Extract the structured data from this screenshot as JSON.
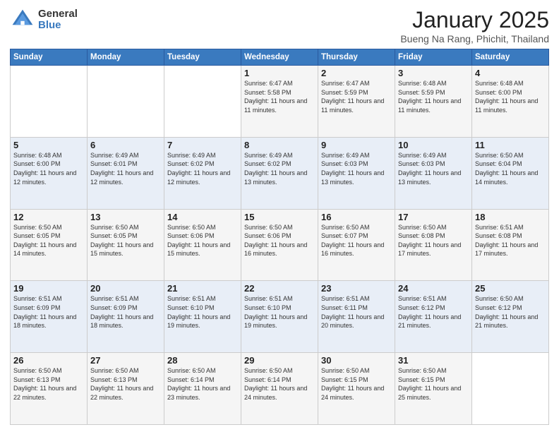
{
  "logo": {
    "general": "General",
    "blue": "Blue"
  },
  "header": {
    "month": "January 2025",
    "location": "Bueng Na Rang, Phichit, Thailand"
  },
  "weekdays": [
    "Sunday",
    "Monday",
    "Tuesday",
    "Wednesday",
    "Thursday",
    "Friday",
    "Saturday"
  ],
  "weeks": [
    [
      {
        "day": "",
        "empty": true
      },
      {
        "day": "",
        "empty": true
      },
      {
        "day": "",
        "empty": true
      },
      {
        "day": "1",
        "sunrise": "6:47 AM",
        "sunset": "5:58 PM",
        "daylight": "11 hours and 11 minutes."
      },
      {
        "day": "2",
        "sunrise": "6:47 AM",
        "sunset": "5:59 PM",
        "daylight": "11 hours and 11 minutes."
      },
      {
        "day": "3",
        "sunrise": "6:48 AM",
        "sunset": "5:59 PM",
        "daylight": "11 hours and 11 minutes."
      },
      {
        "day": "4",
        "sunrise": "6:48 AM",
        "sunset": "6:00 PM",
        "daylight": "11 hours and 11 minutes."
      }
    ],
    [
      {
        "day": "5",
        "sunrise": "6:48 AM",
        "sunset": "6:00 PM",
        "daylight": "11 hours and 12 minutes."
      },
      {
        "day": "6",
        "sunrise": "6:49 AM",
        "sunset": "6:01 PM",
        "daylight": "11 hours and 12 minutes."
      },
      {
        "day": "7",
        "sunrise": "6:49 AM",
        "sunset": "6:02 PM",
        "daylight": "11 hours and 12 minutes."
      },
      {
        "day": "8",
        "sunrise": "6:49 AM",
        "sunset": "6:02 PM",
        "daylight": "11 hours and 13 minutes."
      },
      {
        "day": "9",
        "sunrise": "6:49 AM",
        "sunset": "6:03 PM",
        "daylight": "11 hours and 13 minutes."
      },
      {
        "day": "10",
        "sunrise": "6:49 AM",
        "sunset": "6:03 PM",
        "daylight": "11 hours and 13 minutes."
      },
      {
        "day": "11",
        "sunrise": "6:50 AM",
        "sunset": "6:04 PM",
        "daylight": "11 hours and 14 minutes."
      }
    ],
    [
      {
        "day": "12",
        "sunrise": "6:50 AM",
        "sunset": "6:05 PM",
        "daylight": "11 hours and 14 minutes."
      },
      {
        "day": "13",
        "sunrise": "6:50 AM",
        "sunset": "6:05 PM",
        "daylight": "11 hours and 15 minutes."
      },
      {
        "day": "14",
        "sunrise": "6:50 AM",
        "sunset": "6:06 PM",
        "daylight": "11 hours and 15 minutes."
      },
      {
        "day": "15",
        "sunrise": "6:50 AM",
        "sunset": "6:06 PM",
        "daylight": "11 hours and 16 minutes."
      },
      {
        "day": "16",
        "sunrise": "6:50 AM",
        "sunset": "6:07 PM",
        "daylight": "11 hours and 16 minutes."
      },
      {
        "day": "17",
        "sunrise": "6:50 AM",
        "sunset": "6:08 PM",
        "daylight": "11 hours and 17 minutes."
      },
      {
        "day": "18",
        "sunrise": "6:51 AM",
        "sunset": "6:08 PM",
        "daylight": "11 hours and 17 minutes."
      }
    ],
    [
      {
        "day": "19",
        "sunrise": "6:51 AM",
        "sunset": "6:09 PM",
        "daylight": "11 hours and 18 minutes."
      },
      {
        "day": "20",
        "sunrise": "6:51 AM",
        "sunset": "6:09 PM",
        "daylight": "11 hours and 18 minutes."
      },
      {
        "day": "21",
        "sunrise": "6:51 AM",
        "sunset": "6:10 PM",
        "daylight": "11 hours and 19 minutes."
      },
      {
        "day": "22",
        "sunrise": "6:51 AM",
        "sunset": "6:10 PM",
        "daylight": "11 hours and 19 minutes."
      },
      {
        "day": "23",
        "sunrise": "6:51 AM",
        "sunset": "6:11 PM",
        "daylight": "11 hours and 20 minutes."
      },
      {
        "day": "24",
        "sunrise": "6:51 AM",
        "sunset": "6:12 PM",
        "daylight": "11 hours and 21 minutes."
      },
      {
        "day": "25",
        "sunrise": "6:50 AM",
        "sunset": "6:12 PM",
        "daylight": "11 hours and 21 minutes."
      }
    ],
    [
      {
        "day": "26",
        "sunrise": "6:50 AM",
        "sunset": "6:13 PM",
        "daylight": "11 hours and 22 minutes."
      },
      {
        "day": "27",
        "sunrise": "6:50 AM",
        "sunset": "6:13 PM",
        "daylight": "11 hours and 22 minutes."
      },
      {
        "day": "28",
        "sunrise": "6:50 AM",
        "sunset": "6:14 PM",
        "daylight": "11 hours and 23 minutes."
      },
      {
        "day": "29",
        "sunrise": "6:50 AM",
        "sunset": "6:14 PM",
        "daylight": "11 hours and 24 minutes."
      },
      {
        "day": "30",
        "sunrise": "6:50 AM",
        "sunset": "6:15 PM",
        "daylight": "11 hours and 24 minutes."
      },
      {
        "day": "31",
        "sunrise": "6:50 AM",
        "sunset": "6:15 PM",
        "daylight": "11 hours and 25 minutes."
      },
      {
        "day": "",
        "empty": true
      }
    ]
  ]
}
